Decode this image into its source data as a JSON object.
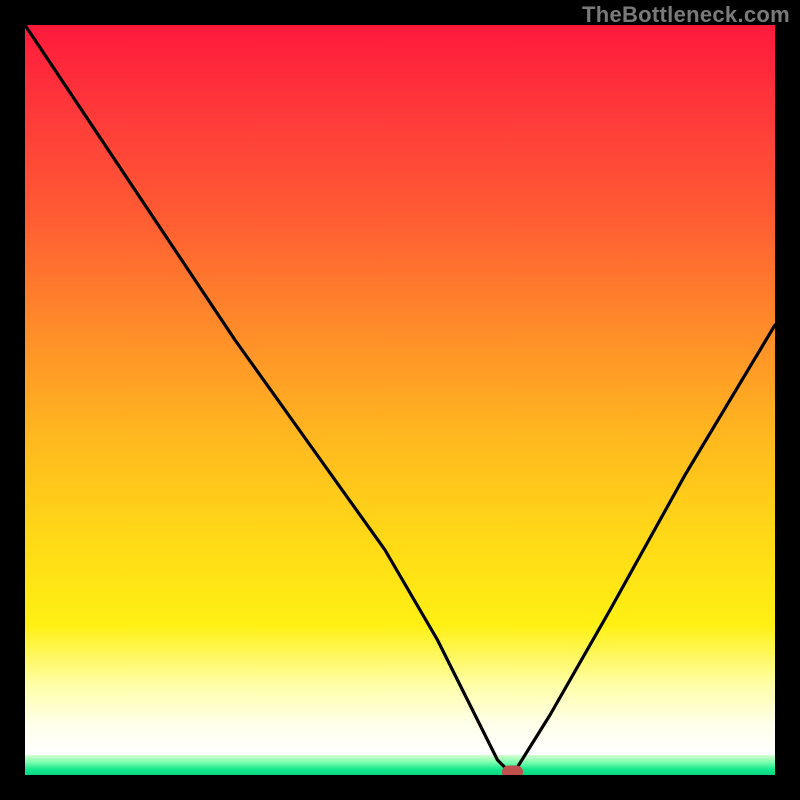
{
  "watermark": "TheBottleneck.com",
  "chart_data": {
    "type": "line",
    "title": "",
    "xlabel": "",
    "ylabel": "",
    "xlim": [
      0,
      100
    ],
    "ylim": [
      0,
      100
    ],
    "grid": false,
    "legend": false,
    "series": [
      {
        "name": "bottleneck-curve",
        "x": [
          0,
          8,
          18,
          28,
          38,
          48,
          55,
          60,
          63,
          65,
          70,
          78,
          88,
          100
        ],
        "values": [
          100,
          88,
          73,
          58,
          44,
          30,
          18,
          8,
          2,
          0,
          8,
          22,
          40,
          60
        ]
      }
    ],
    "marker": {
      "x": 65,
      "y": 0,
      "color": "#c0504d"
    },
    "background_gradient": {
      "top": "#ff1a3c",
      "mid_upper": "#ff8a2a",
      "mid": "#ffd817",
      "mid_lower": "#ffffe8",
      "bottom_band": "#06d67e"
    }
  }
}
